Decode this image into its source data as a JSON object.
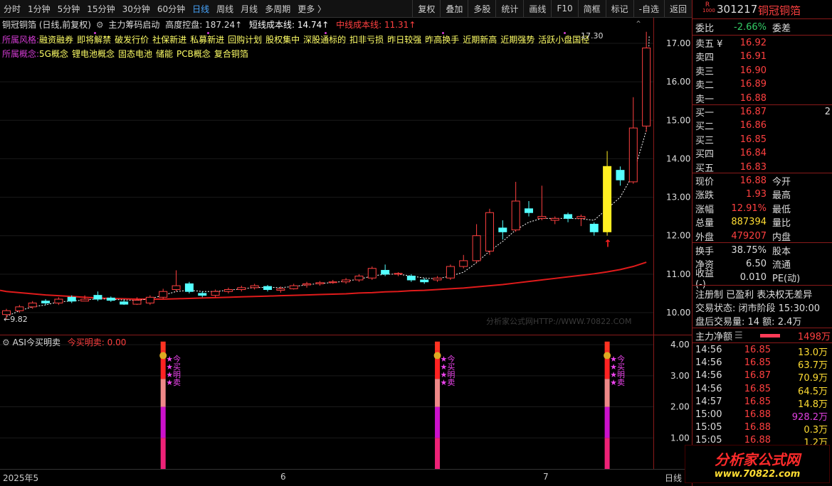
{
  "toolbar": {
    "timeframes": [
      "分时",
      "1分钟",
      "5分钟",
      "15分钟",
      "30分钟",
      "60分钟",
      "日线",
      "周线",
      "月线",
      "多周期",
      "更多 〉"
    ],
    "active": "日线",
    "right_buttons": [
      "复权",
      "叠加",
      "多股",
      "统计",
      "画线",
      "F10",
      "简框",
      "标记",
      "-自选",
      "返回"
    ]
  },
  "chart_header": {
    "title": "铜冠铜箔 (日线,前复权)",
    "indicator": "主力筹码启动",
    "height_label": "高度控盘: 187.24↑",
    "short_label": "短线成本线: 14.74↑",
    "mid_label": "中线成本线: 11.31↑"
  },
  "style_tags": {
    "label": "所属风格:",
    "items": [
      "融资融券",
      "即将解禁",
      "破发行价",
      "社保新进",
      "私募新进",
      "回购计划",
      "股权集中",
      "深股通标的",
      "扣非亏损",
      "昨日较强",
      "昨高换手",
      "近期新高",
      "近期强势",
      "活跃小盘国径"
    ]
  },
  "concept_tags": {
    "label": "所属概念:",
    "items": [
      "5G概念",
      "锂电池概念",
      "固态电池",
      "储能",
      "PCB概念",
      "复合铜箔"
    ]
  },
  "price_axis": [
    "17.00",
    "16.00",
    "15.00",
    "14.00",
    "13.00",
    "12.00",
    "11.00",
    "10.00"
  ],
  "low_label": "←9.82",
  "high_label": "17.30",
  "watermark": "分析家公式网HTTP://WWW.70822.COM",
  "lower_header": {
    "name": "ASI今买明卖",
    "value_label": "今买明卖: 0.00"
  },
  "lower_axis": [
    "4.00",
    "3.00",
    "2.00",
    "1.00"
  ],
  "signal_text": [
    "★今",
    "★买",
    "★明",
    "★卖"
  ],
  "date_axis": [
    "2025年5",
    "6",
    "7"
  ],
  "date_axis_right": "日线",
  "chart_data": {
    "type": "candlestick",
    "ylim": [
      9.7,
      17.45
    ],
    "candles": [
      {
        "o": 9.95,
        "c": 10.05,
        "h": 10.1,
        "l": 9.82
      },
      {
        "o": 10.05,
        "c": 10.15,
        "h": 10.2,
        "l": 10.0
      },
      {
        "o": 10.15,
        "c": 10.25,
        "h": 10.3,
        "l": 10.1
      },
      {
        "o": 10.3,
        "c": 10.25,
        "h": 10.35,
        "l": 10.2
      },
      {
        "o": 10.25,
        "c": 10.35,
        "h": 10.4,
        "l": 10.2
      },
      {
        "o": 10.4,
        "c": 10.3,
        "h": 10.45,
        "l": 10.25
      },
      {
        "o": 10.3,
        "c": 10.35,
        "h": 10.45,
        "l": 10.3
      },
      {
        "o": 10.45,
        "c": 10.35,
        "h": 10.55,
        "l": 10.3
      },
      {
        "o": 10.38,
        "c": 10.32,
        "h": 10.42,
        "l": 10.28
      },
      {
        "o": 10.28,
        "c": 10.22,
        "h": 10.35,
        "l": 10.2
      },
      {
        "o": 10.22,
        "c": 10.32,
        "h": 10.4,
        "l": 10.2
      },
      {
        "o": 10.25,
        "c": 10.4,
        "h": 10.45,
        "l": 10.2
      },
      {
        "o": 10.4,
        "c": 10.55,
        "h": 10.62,
        "l": 10.35
      },
      {
        "o": 10.6,
        "c": 10.7,
        "h": 11.1,
        "l": 10.55
      },
      {
        "o": 10.75,
        "c": 10.55,
        "h": 10.8,
        "l": 10.5
      },
      {
        "o": 10.5,
        "c": 10.45,
        "h": 10.55,
        "l": 10.4
      },
      {
        "o": 10.45,
        "c": 10.55,
        "h": 10.6,
        "l": 10.4
      },
      {
        "o": 10.55,
        "c": 10.6,
        "h": 10.65,
        "l": 10.5
      },
      {
        "o": 10.6,
        "c": 10.65,
        "h": 10.7,
        "l": 10.55
      },
      {
        "o": 10.65,
        "c": 10.7,
        "h": 10.75,
        "l": 10.6
      },
      {
        "o": 10.68,
        "c": 10.6,
        "h": 10.72,
        "l": 10.55
      },
      {
        "o": 10.58,
        "c": 10.62,
        "h": 10.68,
        "l": 10.52
      },
      {
        "o": 10.62,
        "c": 10.7,
        "h": 10.75,
        "l": 10.6
      },
      {
        "o": 10.72,
        "c": 10.75,
        "h": 10.8,
        "l": 10.65
      },
      {
        "o": 10.75,
        "c": 10.78,
        "h": 10.82,
        "l": 10.7
      },
      {
        "o": 10.78,
        "c": 10.8,
        "h": 10.85,
        "l": 10.75
      },
      {
        "o": 10.8,
        "c": 10.85,
        "h": 10.9,
        "l": 10.75
      },
      {
        "o": 10.85,
        "c": 10.95,
        "h": 11.0,
        "l": 10.8
      },
      {
        "o": 10.9,
        "c": 11.15,
        "h": 11.2,
        "l": 10.85
      },
      {
        "o": 11.1,
        "c": 11.0,
        "h": 11.25,
        "l": 10.95
      },
      {
        "o": 11.0,
        "c": 11.02,
        "h": 11.05,
        "l": 10.95
      },
      {
        "o": 10.95,
        "c": 10.85,
        "h": 11.0,
        "l": 10.8
      },
      {
        "o": 10.85,
        "c": 10.8,
        "h": 10.9,
        "l": 10.75
      },
      {
        "o": 10.85,
        "c": 10.9,
        "h": 10.95,
        "l": 10.8
      },
      {
        "o": 10.9,
        "c": 11.2,
        "h": 11.25,
        "l": 10.85
      },
      {
        "o": 11.2,
        "c": 11.35,
        "h": 11.5,
        "l": 11.15
      },
      {
        "o": 11.35,
        "c": 12.0,
        "h": 12.3,
        "l": 11.3
      },
      {
        "o": 11.6,
        "c": 12.6,
        "h": 12.7,
        "l": 11.5
      },
      {
        "o": 12.2,
        "c": 12.1,
        "h": 12.4,
        "l": 11.9
      },
      {
        "o": 12.15,
        "c": 12.9,
        "h": 13.4,
        "l": 12.1
      },
      {
        "o": 12.7,
        "c": 12.6,
        "h": 12.9,
        "l": 12.5
      },
      {
        "o": 12.45,
        "c": 12.5,
        "h": 13.3,
        "l": 12.4
      },
      {
        "o": 12.4,
        "c": 12.45,
        "h": 12.5,
        "l": 12.3
      },
      {
        "o": 12.55,
        "c": 12.45,
        "h": 12.6,
        "l": 12.35
      },
      {
        "o": 12.45,
        "c": 12.5,
        "h": 12.55,
        "l": 12.25
      },
      {
        "o": 12.3,
        "c": 12.1,
        "h": 12.35,
        "l": 12.0
      },
      {
        "o": 12.1,
        "c": 13.8,
        "h": 14.2,
        "l": 12.0
      },
      {
        "o": 13.7,
        "c": 13.45,
        "h": 13.8,
        "l": 13.3
      },
      {
        "o": 13.4,
        "c": 14.8,
        "h": 15.6,
        "l": 13.35
      },
      {
        "o": 14.85,
        "c": 16.88,
        "h": 17.3,
        "l": 14.7
      }
    ],
    "special_index": 46,
    "short_cost_line": [
      9.9,
      10.05,
      10.15,
      10.2,
      10.28,
      10.3,
      10.33,
      10.36,
      10.35,
      10.33,
      10.32,
      10.36,
      10.45,
      10.55,
      10.58,
      10.55,
      10.55,
      10.58,
      10.62,
      10.65,
      10.66,
      10.65,
      10.68,
      10.72,
      10.76,
      10.78,
      10.82,
      10.87,
      10.95,
      11.0,
      11.0,
      10.95,
      10.9,
      10.88,
      10.95,
      11.05,
      11.3,
      11.6,
      11.85,
      12.15,
      12.35,
      12.45,
      12.45,
      12.45,
      12.44,
      12.4,
      12.7,
      13.0,
      13.6,
      14.74
    ],
    "mid_cost_line": [
      10.55,
      10.52,
      10.49,
      10.46,
      10.44,
      10.42,
      10.4,
      10.38,
      10.37,
      10.36,
      10.35,
      10.35,
      10.35,
      10.36,
      10.37,
      10.38,
      10.39,
      10.4,
      10.41,
      10.42,
      10.43,
      10.44,
      10.45,
      10.46,
      10.47,
      10.48,
      10.49,
      10.51,
      10.52,
      10.54,
      10.55,
      10.57,
      10.58,
      10.6,
      10.62,
      10.64,
      10.67,
      10.7,
      10.73,
      10.77,
      10.81,
      10.85,
      10.89,
      10.93,
      10.97,
      11.01,
      11.06,
      11.12,
      11.2,
      11.31
    ],
    "signals": [
      12,
      33,
      46
    ],
    "lower_ylim": [
      0,
      4.3
    ]
  },
  "quote": {
    "code": "301217",
    "name": "铜冠铜箔",
    "badge_r": "R",
    "badge_num": "1000",
    "weibi_label": "委比",
    "weibi": "-2.66%",
    "weicha_label": "委差",
    "asks": [
      {
        "label": "卖五 ¥",
        "price": "16.92"
      },
      {
        "label": "卖四",
        "price": "16.91"
      },
      {
        "label": "卖三",
        "price": "16.90"
      },
      {
        "label": "卖二",
        "price": "16.89"
      },
      {
        "label": "卖一",
        "price": "16.88"
      }
    ],
    "bids": [
      {
        "label": "买一",
        "price": "16.87",
        "vol": "2"
      },
      {
        "label": "买二",
        "price": "16.86",
        "vol": ""
      },
      {
        "label": "买三",
        "price": "16.85",
        "vol": ""
      },
      {
        "label": "买四",
        "price": "16.84",
        "vol": ""
      },
      {
        "label": "买五",
        "price": "16.83",
        "vol": ""
      }
    ],
    "stats": [
      {
        "l": "现价",
        "v": "16.88",
        "r": "今开",
        "cls": "red"
      },
      {
        "l": "涨跌",
        "v": "1.93",
        "r": "最高",
        "cls": "red"
      },
      {
        "l": "涨幅",
        "v": "12.91%",
        "r": "最低",
        "cls": "red"
      },
      {
        "l": "总量",
        "v": "887394",
        "r": "量比",
        "cls": "yellow"
      },
      {
        "l": "外盘",
        "v": "479207",
        "r": "内盘",
        "cls": "red"
      }
    ],
    "stats2": [
      {
        "l": "换手",
        "v": "38.75%",
        "r": "股本",
        "cls": "plain"
      },
      {
        "l": "净资",
        "v": "6.50",
        "r": "流通",
        "cls": "plain"
      },
      {
        "l": "收益(-)",
        "v": "0.010",
        "r": "PE(动)",
        "cls": "plain"
      }
    ],
    "reg_line": "注册制  已盈利  表决权无差异",
    "status_line": "交易状态: 闭市阶段  15:30:00",
    "after_line": "盘后交易量: 14  额: 2.4万",
    "main_net_label": "主力净额",
    "main_net_value": "1498万",
    "trades": [
      {
        "t": "14:56",
        "p": "16.85",
        "v": "13.0万",
        "cls": "yellow"
      },
      {
        "t": "14:56",
        "p": "16.85",
        "v": "63.7万",
        "cls": "yellow"
      },
      {
        "t": "14:56",
        "p": "16.87",
        "v": "70.9万",
        "cls": "yellow"
      },
      {
        "t": "14:56",
        "p": "16.85",
        "v": "64.5万",
        "cls": "yellow"
      },
      {
        "t": "14:57",
        "p": "16.85",
        "v": "14.8万",
        "cls": "yellow"
      },
      {
        "t": "15:00",
        "p": "16.88",
        "v": "928.2万",
        "cls": "magenta"
      },
      {
        "t": "15:05",
        "p": "16.88",
        "v": "0.3万",
        "cls": "yellow"
      },
      {
        "t": "15:05",
        "p": "16.88",
        "v": "1.2万",
        "cls": "yellow"
      }
    ]
  },
  "logo": {
    "line1": "分析家公式网",
    "line2": "www.70822.com"
  },
  "colors": {
    "up": "#ff4040",
    "down": "#54ffff",
    "mid_line": "#e01b1b",
    "special": "#ffee22"
  }
}
